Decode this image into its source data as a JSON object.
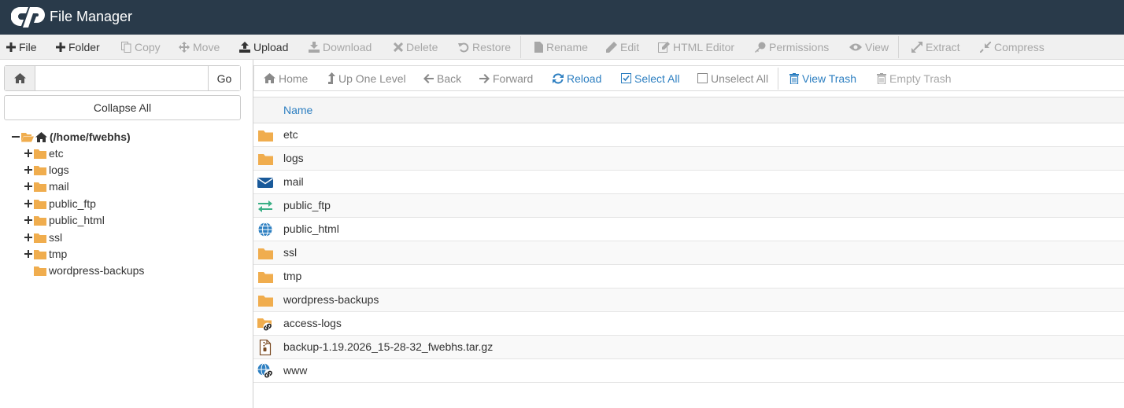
{
  "app": {
    "title": "File Manager"
  },
  "colors": {
    "header_bg": "#293a4a",
    "link_blue": "#2d7fc1",
    "folder_yellow": "#f0ad4e",
    "ftp_green": "#3aaf85",
    "mail_blue": "#1a5a9a"
  },
  "toolbar": {
    "items": [
      {
        "label": "File",
        "icon": "plus-icon",
        "enabled": true
      },
      {
        "label": "Folder",
        "icon": "plus-icon",
        "enabled": true
      },
      {
        "label": "Copy",
        "icon": "copy-icon",
        "enabled": false
      },
      {
        "label": "Move",
        "icon": "move-icon",
        "enabled": false
      },
      {
        "label": "Upload",
        "icon": "upload-icon",
        "enabled": true
      },
      {
        "label": "Download",
        "icon": "download-icon",
        "enabled": false
      },
      {
        "label": "Delete",
        "icon": "delete-icon",
        "enabled": false
      },
      {
        "label": "Restore",
        "icon": "restore-icon",
        "enabled": false
      },
      {
        "label": "Rename",
        "icon": "rename-icon",
        "enabled": false
      },
      {
        "label": "Edit",
        "icon": "pencil-icon",
        "enabled": false
      },
      {
        "label": "HTML Editor",
        "icon": "html-editor-icon",
        "enabled": false
      },
      {
        "label": "Permissions",
        "icon": "key-icon",
        "enabled": false
      },
      {
        "label": "View",
        "icon": "eye-icon",
        "enabled": false
      },
      {
        "label": "Extract",
        "icon": "expand-icon",
        "enabled": false
      },
      {
        "label": "Compress",
        "icon": "compress-icon",
        "enabled": false
      }
    ]
  },
  "sidebar": {
    "path_value": "",
    "go_label": "Go",
    "collapse_label": "Collapse All",
    "tree_root": "(/home/fwebhs)",
    "tree_items": [
      {
        "label": "etc",
        "expandable": true
      },
      {
        "label": "logs",
        "expandable": true
      },
      {
        "label": "mail",
        "expandable": true
      },
      {
        "label": "public_ftp",
        "expandable": true
      },
      {
        "label": "public_html",
        "expandable": true
      },
      {
        "label": "ssl",
        "expandable": true
      },
      {
        "label": "tmp",
        "expandable": true
      },
      {
        "label": "wordpress-backups",
        "expandable": false
      }
    ]
  },
  "nav": {
    "home": "Home",
    "up": "Up One Level",
    "back": "Back",
    "forward": "Forward",
    "reload": "Reload",
    "select_all": "Select All",
    "unselect_all": "Unselect All",
    "view_trash": "View Trash",
    "empty_trash": "Empty Trash"
  },
  "table": {
    "header_name": "Name",
    "rows": [
      {
        "name": "etc",
        "icon": "folder-icon"
      },
      {
        "name": "logs",
        "icon": "folder-icon"
      },
      {
        "name": "mail",
        "icon": "envelope-icon"
      },
      {
        "name": "public_ftp",
        "icon": "exchange-icon"
      },
      {
        "name": "public_html",
        "icon": "globe-icon"
      },
      {
        "name": "ssl",
        "icon": "folder-icon"
      },
      {
        "name": "tmp",
        "icon": "folder-icon"
      },
      {
        "name": "wordpress-backups",
        "icon": "folder-icon"
      },
      {
        "name": "access-logs",
        "icon": "folder-link-icon"
      },
      {
        "name": "backup-1.19.2026_15-28-32_fwebhs.tar.gz",
        "icon": "archive-file-icon"
      },
      {
        "name": "www",
        "icon": "globe-link-icon"
      }
    ]
  }
}
